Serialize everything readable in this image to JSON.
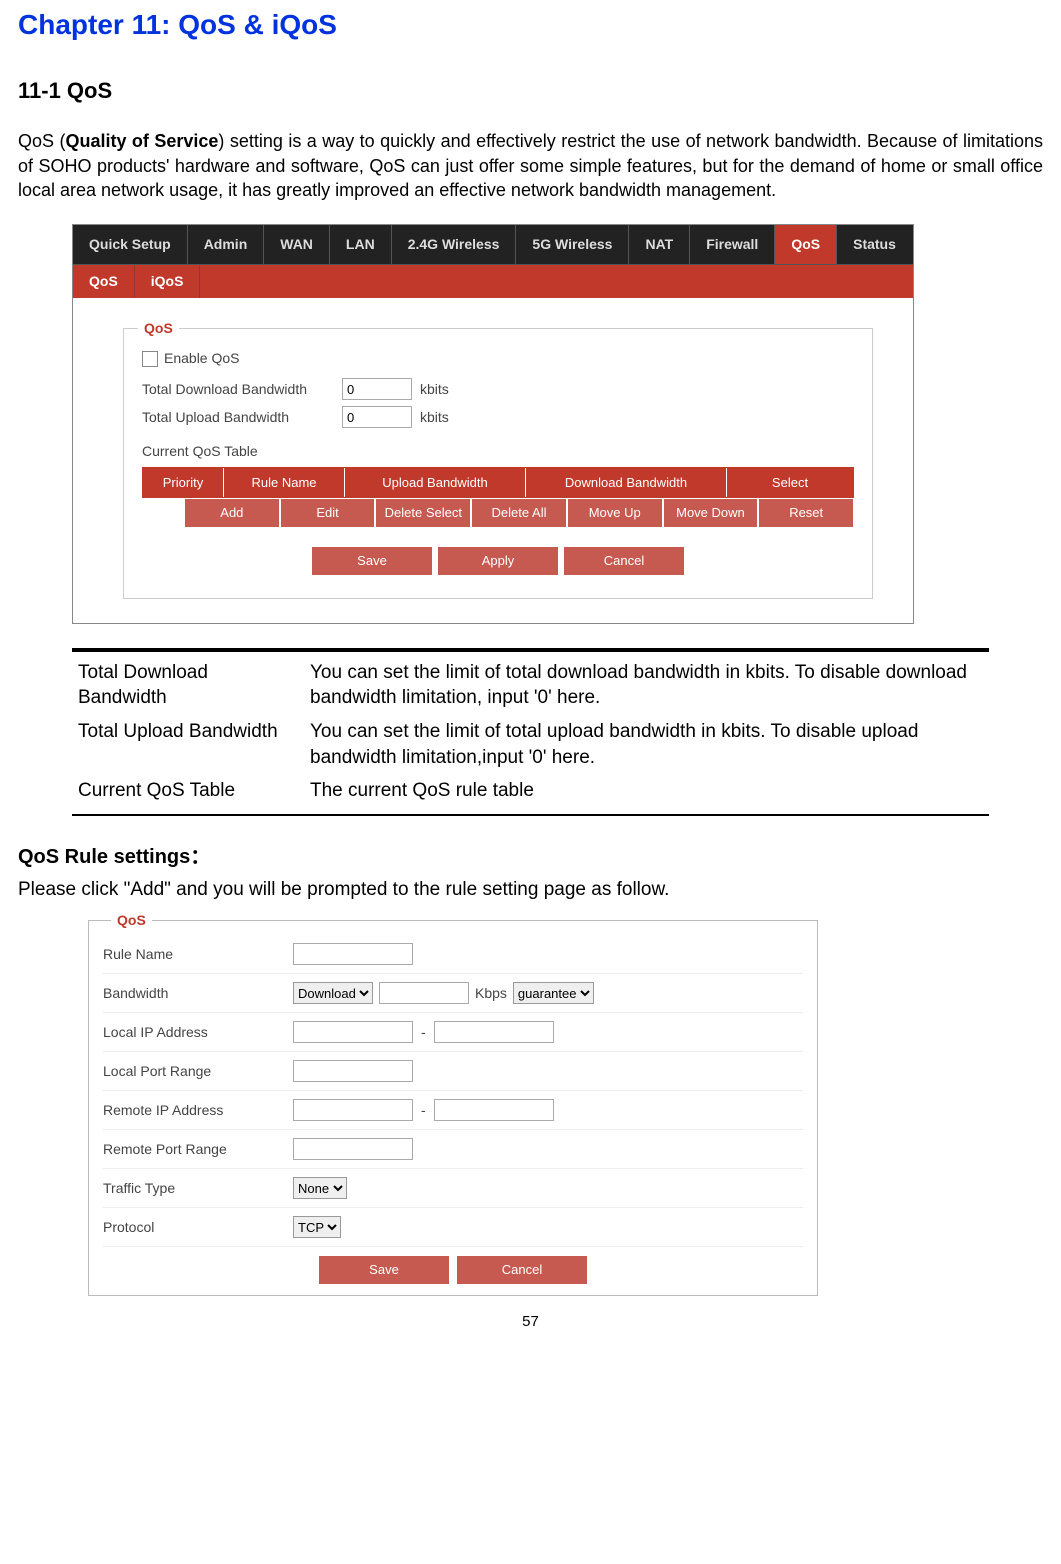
{
  "chapter_title": "Chapter 11: QoS & iQoS",
  "section_title": "11-1 QoS",
  "intro": {
    "prefix": "QoS (",
    "bold": "Quality of Service",
    "rest": ") setting is a way to quickly and effectively restrict the use of network bandwidth. Because of limitations of SOHO products' hardware and software, QoS can just offer some simple features, but for the demand of home or small office local area network usage, it has greatly improved an effective network bandwidth management."
  },
  "nav_main": [
    "Quick Setup",
    "Admin",
    "WAN",
    "LAN",
    "2.4G Wireless",
    "5G Wireless",
    "NAT",
    "Firewall",
    "QoS",
    "Status"
  ],
  "nav_main_active": 8,
  "nav_sub": [
    "QoS",
    "iQoS"
  ],
  "qos_panel": {
    "legend": "QoS",
    "enable_label": "Enable QoS",
    "total_dl_label": "Total Download Bandwidth",
    "total_dl_value": "0",
    "total_ul_label": "Total Upload Bandwidth",
    "total_ul_value": "0",
    "kbits": "kbits",
    "current_table_label": "Current QoS Table",
    "headers": [
      "Priority",
      "Rule Name",
      "Upload Bandwidth",
      "Download Bandwidth",
      "Select"
    ],
    "row_buttons": [
      "Add",
      "Edit",
      "Delete Select",
      "Delete All",
      "Move Up",
      "Move Down",
      "Reset"
    ],
    "bottom_buttons": [
      "Save",
      "Apply",
      "Cancel"
    ]
  },
  "desc_table": [
    {
      "k": "Total Download Bandwidth",
      "v": "You can set the limit of total download bandwidth in kbits. To disable download bandwidth limitation, input '0' here."
    },
    {
      "k": "Total Upload Bandwidth",
      "v": "You can set the limit of total upload bandwidth in kbits. To disable upload bandwidth limitation,input  '0'  here."
    },
    {
      "k": "Current QoS Table",
      "v": "The current QoS rule table"
    }
  ],
  "rule_settings_heading": "QoS Rule settings：",
  "rule_settings_instr": "Please click \"Add\" and you will be prompted to the rule setting page as follow.",
  "qos2": {
    "legend": "QoS",
    "rule_name_label": "Rule Name",
    "bandwidth_label": "Bandwidth",
    "bandwidth_direction": "Download",
    "bandwidth_unit": "Kbps",
    "bandwidth_mode": "guarantee",
    "local_ip_label": "Local IP Address",
    "local_port_label": "Local Port Range",
    "remote_ip_label": "Remote IP Address",
    "remote_port_label": "Remote Port Range",
    "traffic_type_label": "Traffic Type",
    "traffic_type_value": "None",
    "protocol_label": "Protocol",
    "protocol_value": "TCP",
    "buttons": [
      "Save",
      "Cancel"
    ]
  },
  "page_number": "57"
}
